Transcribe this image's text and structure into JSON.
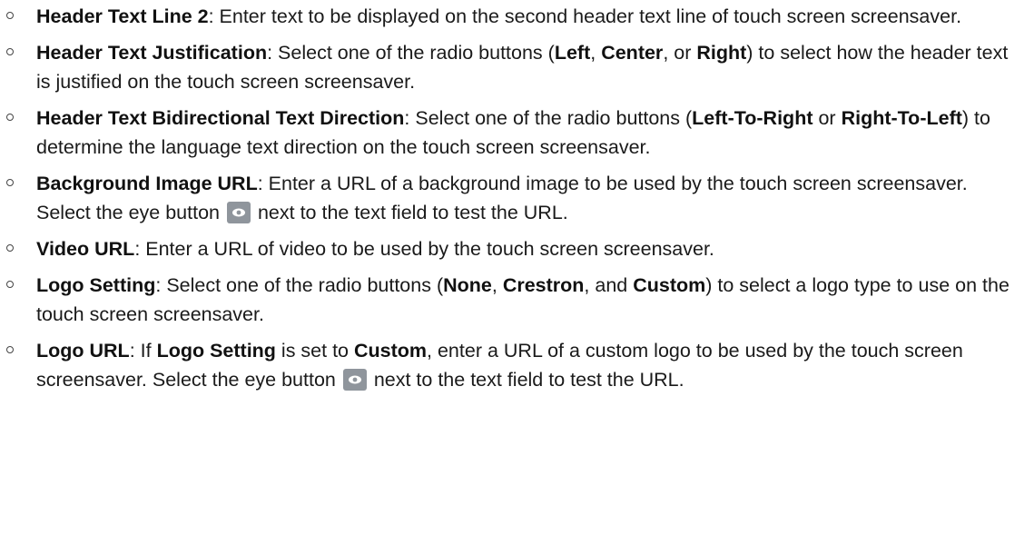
{
  "items": [
    {
      "term": "Header Text Line 2",
      "text": ": Enter text to be displayed on the second header text line of touch screen screensaver."
    },
    {
      "term": "Header Text Justification",
      "text_a": ": Select one of the radio buttons (",
      "opt1": "Left",
      "sep1": ", ",
      "opt2": "Center",
      "sep2": ", or ",
      "opt3": "Right",
      "text_b": ") to select how the header text is justified on the touch screen screensaver."
    },
    {
      "term": "Header Text Bidirectional Text Direction",
      "text_a": ": Select one of the radio buttons (",
      "opt1": "Left-To-Right",
      "sep1": " or ",
      "opt2": "Right-To-Left",
      "text_b": ") to determine the language text direction on the touch screen screensaver."
    },
    {
      "term": "Background Image URL",
      "text_a": ": Enter a URL of a background image to be used by the touch screen screensaver. Select the eye button ",
      "icon": "eye-icon",
      "text_b": " next to the text field to test the URL."
    },
    {
      "term": "Video URL",
      "text": ": Enter a URL of video to be used by the touch screen screensaver."
    },
    {
      "term": "Logo Setting",
      "text_a": ": Select one of the radio buttons (",
      "opt1": "None",
      "sep1": ", ",
      "opt2": "Crestron",
      "sep2": ", and ",
      "opt3": "Custom",
      "text_b": ") to select a logo type to use on the touch screen screensaver."
    },
    {
      "term": "Logo URL",
      "text_a": ": If ",
      "ref1": "Logo Setting",
      "text_b": " is set to ",
      "ref2": "Custom",
      "text_c": ", enter a URL of a custom logo to be used by the touch screen screensaver. Select the eye button ",
      "icon": "eye-icon",
      "text_d": " next to the text field to test the URL."
    }
  ],
  "colors": {
    "text": "#1a1a1a",
    "eye_button_bg": "#8f959c"
  }
}
